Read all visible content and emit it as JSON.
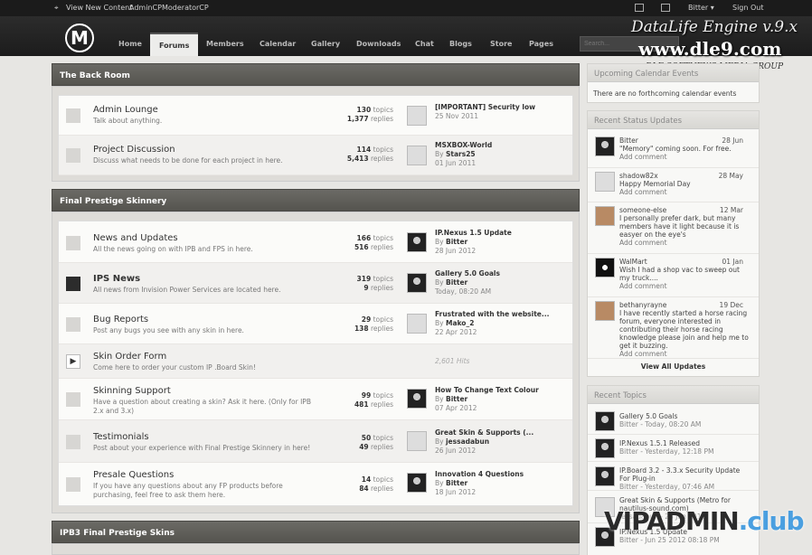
{
  "topbar": {
    "view_new": "View New Content",
    "admincp": "AdminCP",
    "modcp": "ModeratorCP",
    "user": "Bitter",
    "user_arrow": "▾",
    "signout": "Sign Out"
  },
  "nav": {
    "logo": "M",
    "items": [
      "Home",
      "Forums",
      "Members",
      "Calendar",
      "Gallery",
      "Downloads",
      "Chat",
      "Blogs",
      "Store",
      "Pages"
    ],
    "active": "Forums",
    "search_placeholder": "Search..."
  },
  "watermark": {
    "line1": "DataLife Engine v.9.x",
    "line2": "www.dle9.com",
    "line3": "DLE SOFTNEWS MEDIA GROUP",
    "bottom_a": "VIPADMIN",
    "bottom_b": ".club"
  },
  "categories": [
    {
      "title": "The Back Room",
      "forums": [
        {
          "title": "Admin Lounge",
          "desc": "Talk about anything.",
          "topics": "130",
          "replies": "1,377",
          "last_title": "[IMPORTANT] Security low",
          "last_by": "",
          "last_date": "25 Nov 2011"
        },
        {
          "title": "Project Discussion",
          "desc": "Discuss what needs to be done for each project in here.",
          "topics": "114",
          "replies": "5,413",
          "last_title": "MSXBOX-World",
          "last_by": "Stars25",
          "last_date": "01 Jun 2011"
        }
      ]
    },
    {
      "title": "Final Prestige Skinnery",
      "forums": [
        {
          "title": "News and Updates",
          "desc": "All the news going on with IPB and FPS in here.",
          "topics": "166",
          "replies": "516",
          "last_title": "IP.Nexus 1.5 Update",
          "last_by": "Bitter",
          "last_date": "28 Jun 2012"
        },
        {
          "title": "IPS News",
          "desc": "All news from Invision Power Services are located here.",
          "topics": "319",
          "replies": "9",
          "last_title": "Gallery 5.0 Goals",
          "last_by": "Bitter",
          "last_date": "Today, 08:20 AM"
        },
        {
          "title": "Bug Reports",
          "desc": "Post any bugs you see with any skin in here.",
          "topics": "29",
          "replies": "138",
          "last_title": "Frustrated with the website...",
          "last_by": "Mako_2",
          "last_date": "22 Apr 2012"
        },
        {
          "title": "Skin Order Form",
          "desc": "Come here to order your custom IP .Board Skin!",
          "hits": "2,601 Hits"
        },
        {
          "title": "Skinning Support",
          "desc": "Have a question about creating a skin? Ask it here. (Only for IPB 2.x and 3.x)",
          "topics": "99",
          "replies": "481",
          "last_title": "How To Change Text Colour",
          "last_by": "Bitter",
          "last_date": "07 Apr 2012"
        },
        {
          "title": "Testimonials",
          "desc": "Post about your experience with Final Prestige Skinnery in here!",
          "topics": "50",
          "replies": "49",
          "last_title": "Great Skin & Supports (...",
          "last_by": "jessadabun",
          "last_date": "26 Jun 2012"
        },
        {
          "title": "Presale Questions",
          "desc": "If you have any questions about any FP products before purchasing, feel free to ask them here.",
          "topics": "14",
          "replies": "84",
          "last_title": "Innovation 4 Questions",
          "last_by": "Bitter",
          "last_date": "18 Jun 2012"
        }
      ]
    },
    {
      "title": "IPB3 Final Prestige Skins"
    }
  ],
  "labels": {
    "topics": "topics",
    "replies": "replies",
    "by": "By"
  },
  "sidebar": {
    "calendar_title": "Upcoming Calendar Events",
    "calendar_empty": "There are no forthcoming calendar events",
    "status_title": "Recent Status Updates",
    "add_comment": "Add comment",
    "view_all": "View All Updates",
    "statuses": [
      {
        "user": "Bitter",
        "date": "28 Jun",
        "text": "\"Memory\" coming soon. For free."
      },
      {
        "user": "shadow82x",
        "date": "28 May",
        "text": "Happy Memorial Day"
      },
      {
        "user": "someone-else",
        "date": "12 Mar",
        "text": "I personally prefer dark, but many members have it light because it is easyer on the eye's"
      },
      {
        "user": "WalMart",
        "date": "01 Jan",
        "text": "Wish I had a shop vac to sweep out my truck...."
      },
      {
        "user": "bethanyrayne",
        "date": "19 Dec",
        "text": "I have recently started a horse racing forum, everyone interested in contributing their horse racing knowledge please join and help me to get it buzzing."
      }
    ],
    "topics_title": "Recent Topics",
    "topics": [
      {
        "title": "Gallery 5.0 Goals",
        "meta": "Bitter - Today, 08:20 AM"
      },
      {
        "title": "IP.Nexus 1.5.1 Released",
        "meta": "Bitter - Yesterday, 12:18 PM"
      },
      {
        "title": "IP.Board 3.2 - 3.3.x Security Update For Plug-in",
        "meta": "Bitter - Yesterday, 07:46 AM"
      },
      {
        "title": "Great Skin & Supports (Metro for nautilus-sound.com)",
        "meta": "jessadabun - 26 Jun 2012"
      },
      {
        "title": "IP.Nexus 1.5 Update",
        "meta": "Bitter - Jun 25 2012 08:18 PM"
      }
    ]
  }
}
